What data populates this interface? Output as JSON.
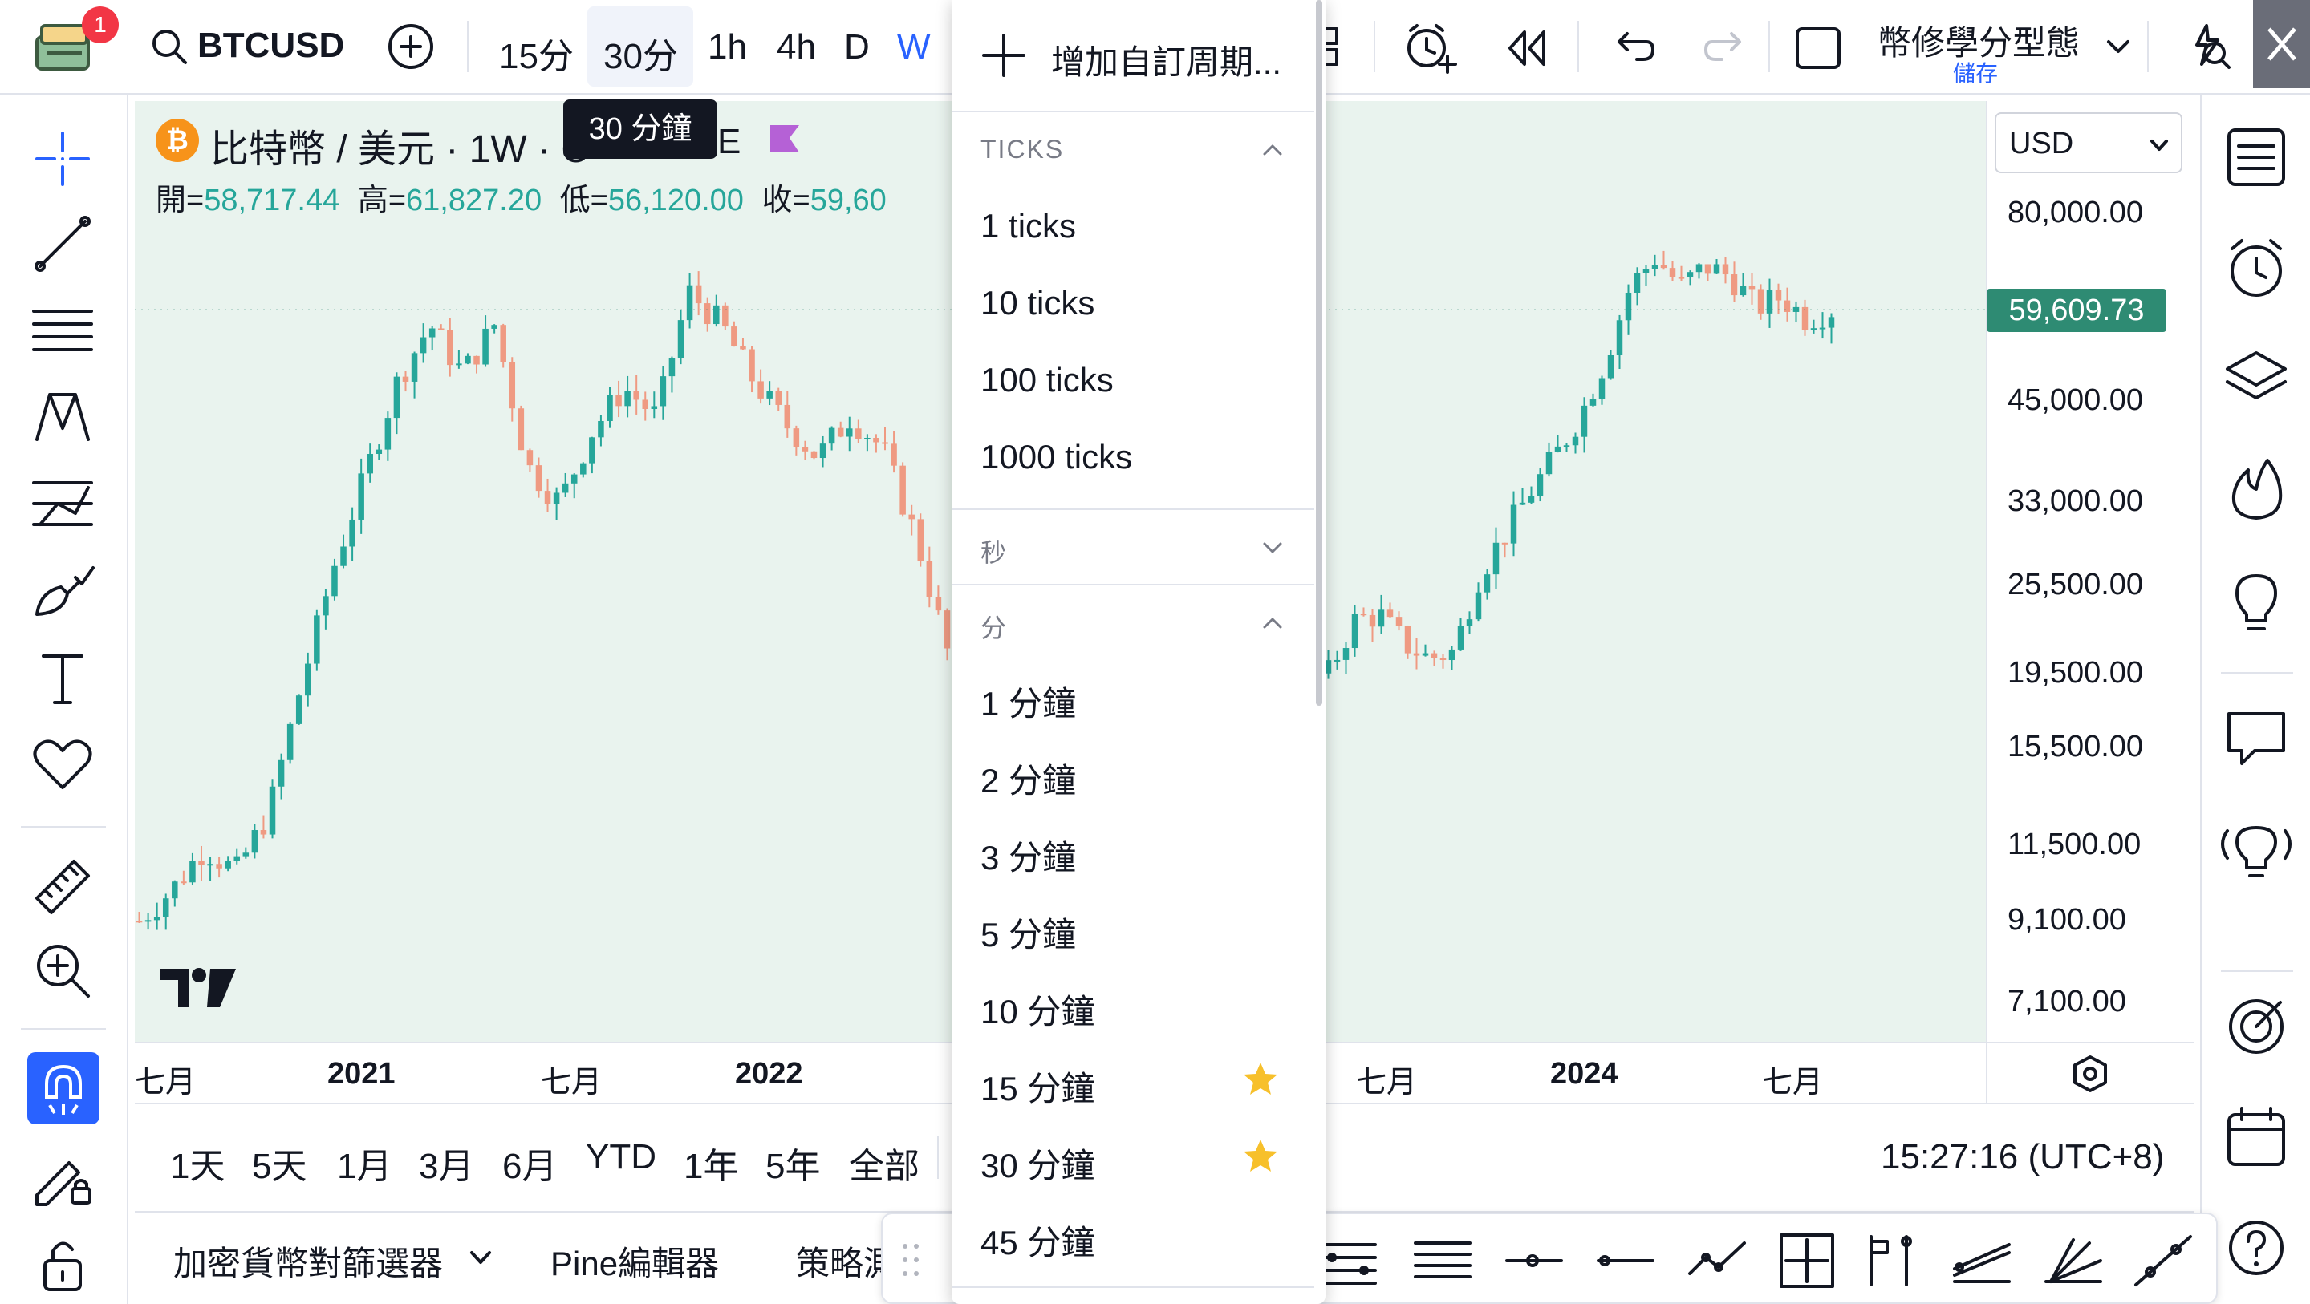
{
  "app": {
    "notification_count": "1",
    "colors": {
      "accent": "#2962ff",
      "up": "#26a69a",
      "down": "#ef9a82",
      "chart_bg": "#e9f3ee",
      "price_tag": "#2e8b73"
    }
  },
  "toolbar": {
    "symbol": "BTCUSD",
    "intervals": [
      "15分",
      "30分",
      "1h",
      "4h",
      "D",
      "W"
    ],
    "layout_name": "幣修學分型態",
    "layout_status": "儲存"
  },
  "tooltip": {
    "text": "30 分鐘"
  },
  "legend": {
    "title_a": "比特幣 / 美元 · 1W · C",
    "title_b": "E",
    "open_label": "開=",
    "open_value": "58,717.44",
    "high_label": "高=",
    "high_value": "61,827.20",
    "low_label": "低=",
    "low_value": "56,120.00",
    "close_label": "收=",
    "close_value": "59,60"
  },
  "price_axis": {
    "currency": "USD",
    "labels": [
      "80,000.00",
      "45,000.00",
      "33,000.00",
      "25,500.00",
      "19,500.00",
      "15,500.00",
      "11,500.00",
      "9,100.00",
      "7,100.00"
    ],
    "current_price": "59,609.73"
  },
  "time_axis": {
    "labels": [
      "七月",
      "2021",
      "七月",
      "2022",
      "七月",
      "2024",
      "七月"
    ]
  },
  "ranges": [
    "1天",
    "5天",
    "1月",
    "3月",
    "6月",
    "YTD",
    "1年",
    "5年",
    "全部"
  ],
  "clock": "15:27:16 (UTC+8)",
  "bottom_tabs": [
    "加密貨幣對篩選器",
    "Pine編輯器",
    "策略測"
  ],
  "dropdown": {
    "add_custom": "增加自訂周期...",
    "sections": {
      "ticks": {
        "label": "TICKS",
        "items": [
          "1 ticks",
          "10 ticks",
          "100 ticks",
          "1000 ticks"
        ]
      },
      "seconds": {
        "label": "秒"
      },
      "minutes": {
        "label": "分",
        "items": [
          "1 分鐘",
          "2 分鐘",
          "3 分鐘",
          "5 分鐘",
          "10 分鐘",
          "15 分鐘",
          "30 分鐘",
          "45 分鐘"
        ]
      }
    },
    "favorites": [
      "15 分鐘",
      "30 分鐘"
    ]
  },
  "chart_data": {
    "type": "candlestick",
    "symbol": "BTCUSD",
    "interval": "1W",
    "scale": "log",
    "y_ticks": [
      80000,
      45000,
      33000,
      25500,
      19500,
      15500,
      11500,
      9100,
      7100
    ],
    "last_price": 59609.73,
    "ohlc_last": {
      "open": 58717.44,
      "high": 61827.2,
      "low": 56120.0
    },
    "approx_closes_left": [
      9200,
      10100,
      11500,
      10700,
      12800,
      18800,
      27000,
      36000,
      48000,
      57000,
      49000,
      57000,
      37000,
      33000,
      41000,
      47000,
      43000,
      63000,
      57000,
      48000,
      42000,
      38000,
      43000,
      39000,
      30000,
      21000
    ],
    "approx_closes_right": [
      19600,
      23000,
      23500,
      21500,
      20500,
      21000,
      26500,
      30000,
      34000,
      38000,
      43000,
      51000,
      64000,
      70000,
      64000,
      68000,
      66000,
      60000,
      62000,
      58000,
      59609
    ]
  }
}
